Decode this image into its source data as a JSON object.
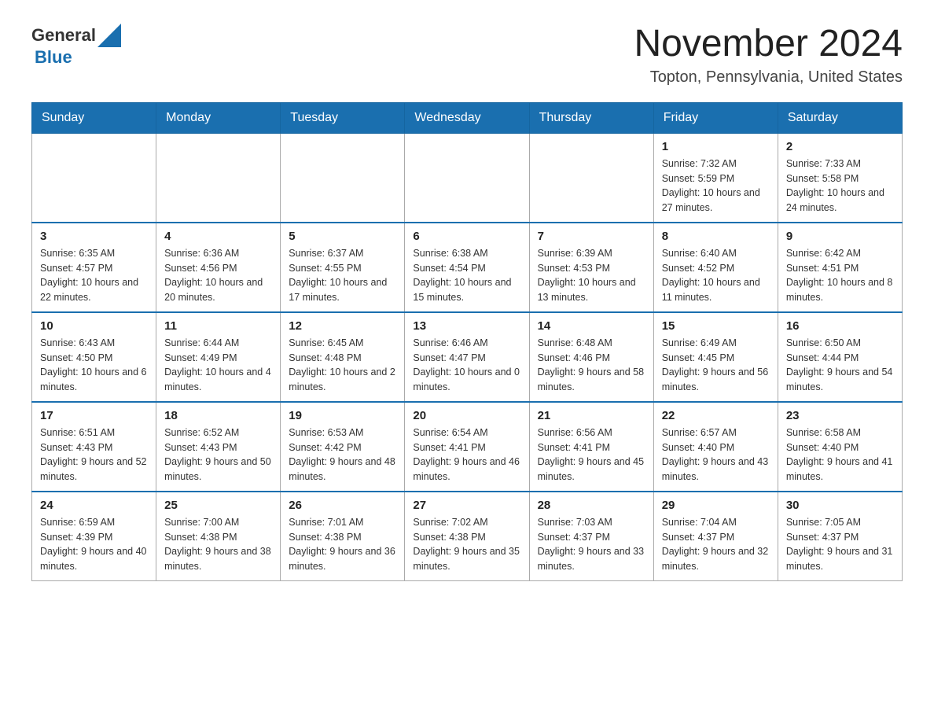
{
  "header": {
    "logo_general": "General",
    "logo_blue": "Blue",
    "month_title": "November 2024",
    "location": "Topton, Pennsylvania, United States"
  },
  "days_of_week": [
    "Sunday",
    "Monday",
    "Tuesday",
    "Wednesday",
    "Thursday",
    "Friday",
    "Saturday"
  ],
  "weeks": [
    [
      {
        "day": "",
        "info": ""
      },
      {
        "day": "",
        "info": ""
      },
      {
        "day": "",
        "info": ""
      },
      {
        "day": "",
        "info": ""
      },
      {
        "day": "",
        "info": ""
      },
      {
        "day": "1",
        "info": "Sunrise: 7:32 AM\nSunset: 5:59 PM\nDaylight: 10 hours and 27 minutes."
      },
      {
        "day": "2",
        "info": "Sunrise: 7:33 AM\nSunset: 5:58 PM\nDaylight: 10 hours and 24 minutes."
      }
    ],
    [
      {
        "day": "3",
        "info": "Sunrise: 6:35 AM\nSunset: 4:57 PM\nDaylight: 10 hours and 22 minutes."
      },
      {
        "day": "4",
        "info": "Sunrise: 6:36 AM\nSunset: 4:56 PM\nDaylight: 10 hours and 20 minutes."
      },
      {
        "day": "5",
        "info": "Sunrise: 6:37 AM\nSunset: 4:55 PM\nDaylight: 10 hours and 17 minutes."
      },
      {
        "day": "6",
        "info": "Sunrise: 6:38 AM\nSunset: 4:54 PM\nDaylight: 10 hours and 15 minutes."
      },
      {
        "day": "7",
        "info": "Sunrise: 6:39 AM\nSunset: 4:53 PM\nDaylight: 10 hours and 13 minutes."
      },
      {
        "day": "8",
        "info": "Sunrise: 6:40 AM\nSunset: 4:52 PM\nDaylight: 10 hours and 11 minutes."
      },
      {
        "day": "9",
        "info": "Sunrise: 6:42 AM\nSunset: 4:51 PM\nDaylight: 10 hours and 8 minutes."
      }
    ],
    [
      {
        "day": "10",
        "info": "Sunrise: 6:43 AM\nSunset: 4:50 PM\nDaylight: 10 hours and 6 minutes."
      },
      {
        "day": "11",
        "info": "Sunrise: 6:44 AM\nSunset: 4:49 PM\nDaylight: 10 hours and 4 minutes."
      },
      {
        "day": "12",
        "info": "Sunrise: 6:45 AM\nSunset: 4:48 PM\nDaylight: 10 hours and 2 minutes."
      },
      {
        "day": "13",
        "info": "Sunrise: 6:46 AM\nSunset: 4:47 PM\nDaylight: 10 hours and 0 minutes."
      },
      {
        "day": "14",
        "info": "Sunrise: 6:48 AM\nSunset: 4:46 PM\nDaylight: 9 hours and 58 minutes."
      },
      {
        "day": "15",
        "info": "Sunrise: 6:49 AM\nSunset: 4:45 PM\nDaylight: 9 hours and 56 minutes."
      },
      {
        "day": "16",
        "info": "Sunrise: 6:50 AM\nSunset: 4:44 PM\nDaylight: 9 hours and 54 minutes."
      }
    ],
    [
      {
        "day": "17",
        "info": "Sunrise: 6:51 AM\nSunset: 4:43 PM\nDaylight: 9 hours and 52 minutes."
      },
      {
        "day": "18",
        "info": "Sunrise: 6:52 AM\nSunset: 4:43 PM\nDaylight: 9 hours and 50 minutes."
      },
      {
        "day": "19",
        "info": "Sunrise: 6:53 AM\nSunset: 4:42 PM\nDaylight: 9 hours and 48 minutes."
      },
      {
        "day": "20",
        "info": "Sunrise: 6:54 AM\nSunset: 4:41 PM\nDaylight: 9 hours and 46 minutes."
      },
      {
        "day": "21",
        "info": "Sunrise: 6:56 AM\nSunset: 4:41 PM\nDaylight: 9 hours and 45 minutes."
      },
      {
        "day": "22",
        "info": "Sunrise: 6:57 AM\nSunset: 4:40 PM\nDaylight: 9 hours and 43 minutes."
      },
      {
        "day": "23",
        "info": "Sunrise: 6:58 AM\nSunset: 4:40 PM\nDaylight: 9 hours and 41 minutes."
      }
    ],
    [
      {
        "day": "24",
        "info": "Sunrise: 6:59 AM\nSunset: 4:39 PM\nDaylight: 9 hours and 40 minutes."
      },
      {
        "day": "25",
        "info": "Sunrise: 7:00 AM\nSunset: 4:38 PM\nDaylight: 9 hours and 38 minutes."
      },
      {
        "day": "26",
        "info": "Sunrise: 7:01 AM\nSunset: 4:38 PM\nDaylight: 9 hours and 36 minutes."
      },
      {
        "day": "27",
        "info": "Sunrise: 7:02 AM\nSunset: 4:38 PM\nDaylight: 9 hours and 35 minutes."
      },
      {
        "day": "28",
        "info": "Sunrise: 7:03 AM\nSunset: 4:37 PM\nDaylight: 9 hours and 33 minutes."
      },
      {
        "day": "29",
        "info": "Sunrise: 7:04 AM\nSunset: 4:37 PM\nDaylight: 9 hours and 32 minutes."
      },
      {
        "day": "30",
        "info": "Sunrise: 7:05 AM\nSunset: 4:37 PM\nDaylight: 9 hours and 31 minutes."
      }
    ]
  ]
}
